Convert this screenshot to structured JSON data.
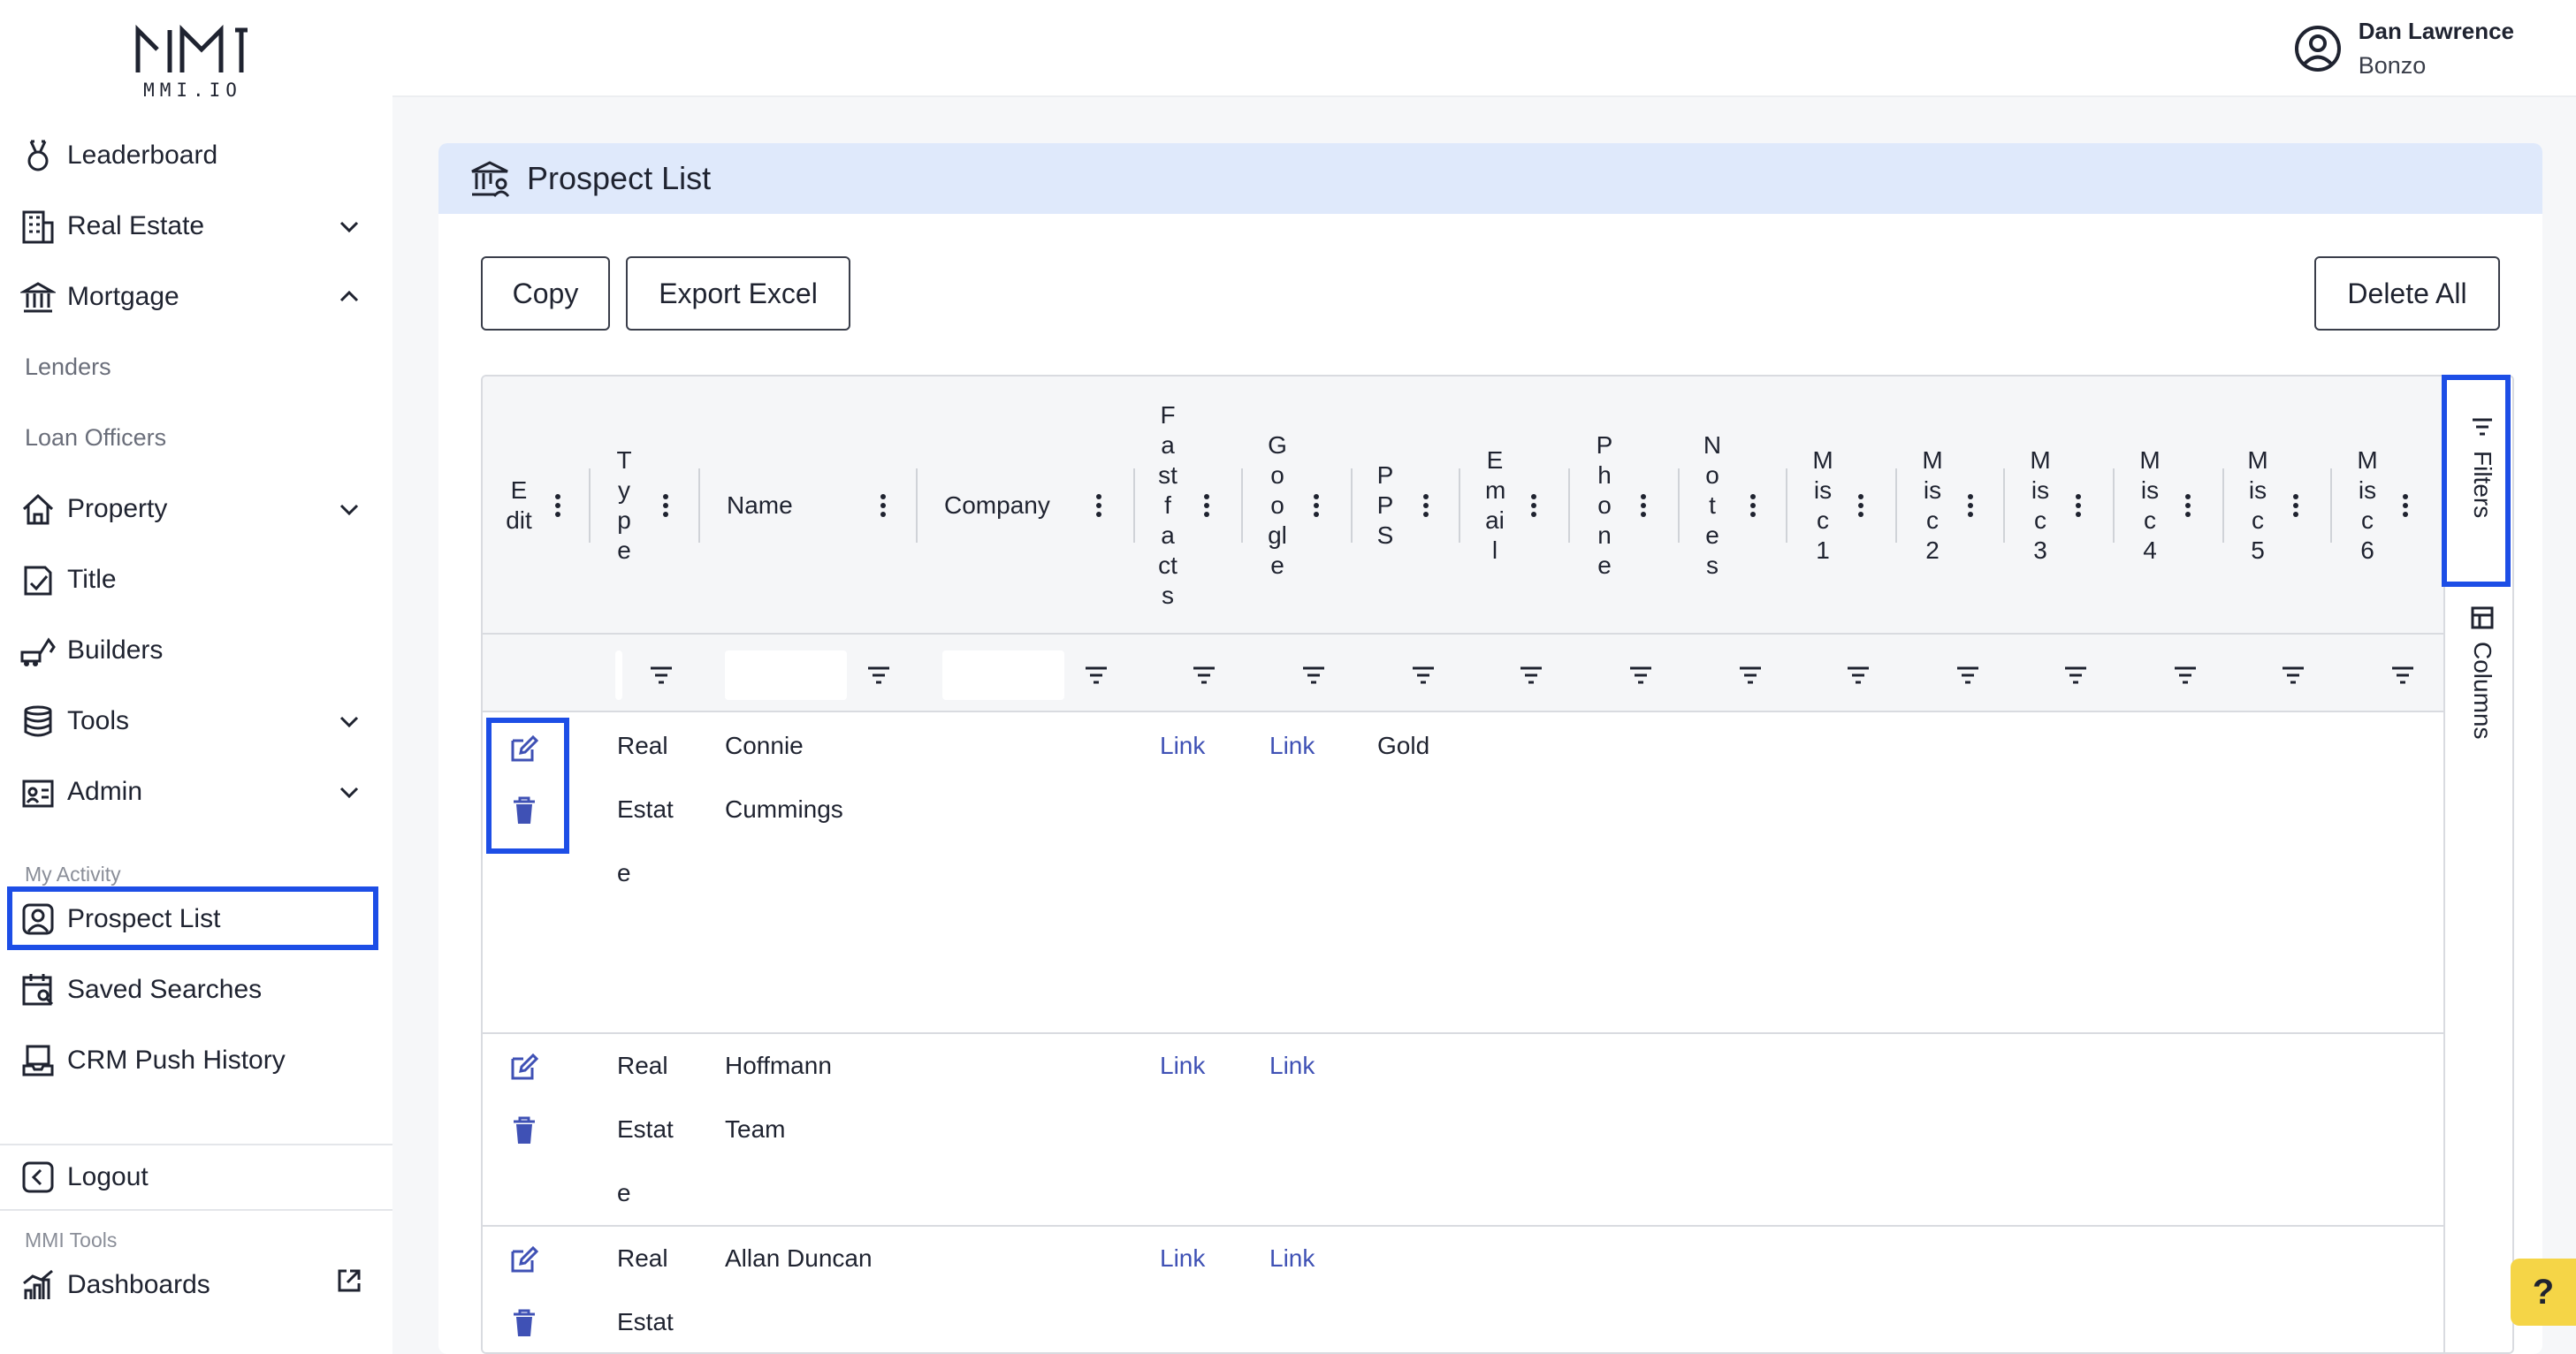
{
  "brand": {
    "logo_text": "MMI.IO"
  },
  "sidebar": {
    "items": [
      {
        "label": "Leaderboard",
        "icon": "award-icon"
      },
      {
        "label": "Real Estate",
        "icon": "building-icon"
      },
      {
        "label": "Mortgage",
        "icon": "bank-icon"
      },
      {
        "label": "Property",
        "icon": "home-icon"
      },
      {
        "label": "Title",
        "icon": "title-doc-icon"
      },
      {
        "label": "Builders",
        "icon": "excavator-icon"
      },
      {
        "label": "Tools",
        "icon": "database-icon"
      },
      {
        "label": "Admin",
        "icon": "id-card-icon"
      }
    ],
    "mortgage_sub": [
      "Lenders",
      "Loan Officers"
    ],
    "my_activity_label": "My Activity",
    "activity_items": [
      {
        "label": "Prospect List",
        "icon": "user-square-icon"
      },
      {
        "label": "Saved Searches",
        "icon": "calendar-search-icon"
      },
      {
        "label": "CRM Push History",
        "icon": "inbox-icon"
      }
    ],
    "logout_label": "Logout",
    "mmi_tools_label": "MMI Tools",
    "dashboards_label": "Dashboards"
  },
  "user": {
    "name": "Dan Lawrence",
    "role": "Bonzo"
  },
  "page": {
    "title": "Prospect List"
  },
  "toolbar": {
    "copy_label": "Copy",
    "export_label": "Export Excel",
    "delete_all_label": "Delete All"
  },
  "grid": {
    "columns": [
      "Edit",
      "Type",
      "Name",
      "Company",
      "Fastfacts",
      "Google",
      "PPS",
      "Email",
      "Phone",
      "Notes",
      "Misc1",
      "Misc2",
      "Misc3",
      "Misc4",
      "Misc5",
      "Misc6"
    ],
    "side_panel": {
      "filters_label": "Filters",
      "columns_label": "Columns"
    },
    "rows": [
      {
        "type_lines": [
          "Real",
          "Estat",
          "e"
        ],
        "name_lines": [
          "Connie",
          "Cummings"
        ],
        "fastfacts": "Link",
        "google": "Link",
        "pps": "Gold"
      },
      {
        "type_lines": [
          "Real",
          "Estat",
          "e"
        ],
        "name_lines": [
          "Hoffmann",
          "Team"
        ],
        "fastfacts": "Link",
        "google": "Link",
        "pps": ""
      },
      {
        "type_lines": [
          "Real",
          "Estat"
        ],
        "name_lines": [
          "Allan Duncan"
        ],
        "fastfacts": "Link",
        "google": "Link",
        "pps": ""
      }
    ]
  },
  "help": {
    "label": "?"
  },
  "colors": {
    "accent": "#1d4ee6",
    "header_bg": "#dfe9fb",
    "link": "#3f51b5",
    "help_bg": "#f5d547"
  }
}
